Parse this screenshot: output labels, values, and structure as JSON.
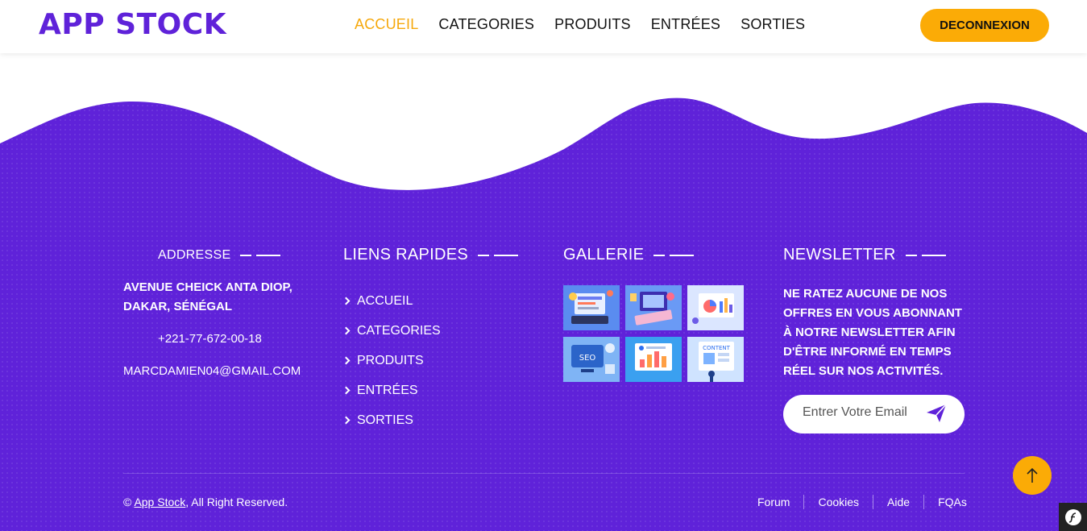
{
  "header": {
    "logo": "APP STOCK",
    "nav": [
      "ACCUEIL",
      "CATEGORIES",
      "PRODUITS",
      "ENTRÉES",
      "SORTIES"
    ],
    "active_nav": "ACCUEIL",
    "logout_label": "DECONNEXION"
  },
  "footer": {
    "address": {
      "title": "ADDRESSE",
      "lines": [
        "AVENUE CHEICK ANTA DIOP,",
        "DAKAR, SÉNÉGAL"
      ],
      "phone": "+221-77-672-00-18",
      "email": "MARCDAMIEN04@GMAIL.COM"
    },
    "quick_links": {
      "title": "LIENS RAPIDES",
      "items": [
        "ACCUEIL",
        "CATEGORIES",
        "PRODUITS",
        "ENTRÉES",
        "SORTIES"
      ]
    },
    "gallery": {
      "title": "GALLERIE",
      "thumb_labels": [
        "SEO",
        "CONTENT"
      ]
    },
    "newsletter": {
      "title": "NEWSLETTER",
      "text": "NE RATEZ AUCUNE DE NOS OFFRES EN VOUS ABONNANT À NOTRE NEWSLETTER AFIN D'ÊTRE INFORMÉ EN TEMPS RÉEL SUR NOS ACTIVITÉS.",
      "email_placeholder": "Entrer Votre Email"
    },
    "copyright_prefix": "© ",
    "copyright_brand": "App Stock",
    "copyright_suffix": ", All Right Reserved.",
    "bottom_links": [
      "Forum",
      "Cookies",
      "Aide",
      "FQAs"
    ]
  },
  "colors": {
    "primary": "#5f22d9",
    "accent": "#fbab06",
    "nav_active": "#f6a80b"
  },
  "icons": [
    "chevron-right-icon",
    "send-icon",
    "arrow-up-icon",
    "symfony-icon"
  ]
}
